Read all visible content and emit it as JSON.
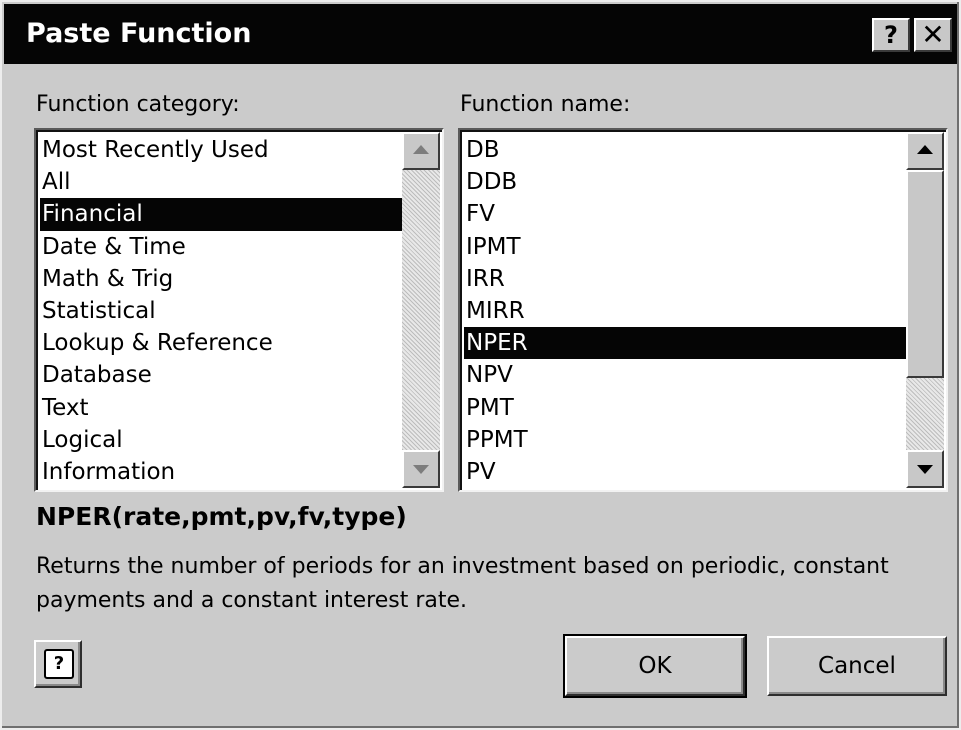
{
  "window": {
    "title": "Paste Function",
    "help_label": "?",
    "close_label": "✕"
  },
  "category": {
    "label": "Function category:",
    "selected": "Financial",
    "items": [
      {
        "label": "Most Recently Used"
      },
      {
        "label": "All"
      },
      {
        "label": "Financial"
      },
      {
        "label": "Date & Time"
      },
      {
        "label": "Math & Trig"
      },
      {
        "label": "Statistical"
      },
      {
        "label": "Lookup & Reference"
      },
      {
        "label": "Database"
      },
      {
        "label": "Text"
      },
      {
        "label": "Logical"
      },
      {
        "label": "Information"
      }
    ]
  },
  "function": {
    "label": "Function name:",
    "selected": "NPER",
    "items": [
      {
        "label": "DB"
      },
      {
        "label": "DDB"
      },
      {
        "label": "FV"
      },
      {
        "label": "IPMT"
      },
      {
        "label": "IRR"
      },
      {
        "label": "MIRR"
      },
      {
        "label": "NPER"
      },
      {
        "label": "NPV"
      },
      {
        "label": "PMT"
      },
      {
        "label": "PPMT"
      },
      {
        "label": "PV"
      }
    ]
  },
  "syntax": "NPER(rate,pmt,pv,fv,type)",
  "description": "Returns the number of periods for an investment based on periodic, constant payments and a constant interest rate.",
  "buttons": {
    "ok": "OK",
    "cancel": "Cancel",
    "help": "?"
  },
  "icons": {
    "help": "question-mark-icon",
    "close": "close-icon",
    "scroll_up": "arrow-up-icon",
    "scroll_down": "arrow-down-icon",
    "office_assistant": "office-assistant-help-icon"
  }
}
